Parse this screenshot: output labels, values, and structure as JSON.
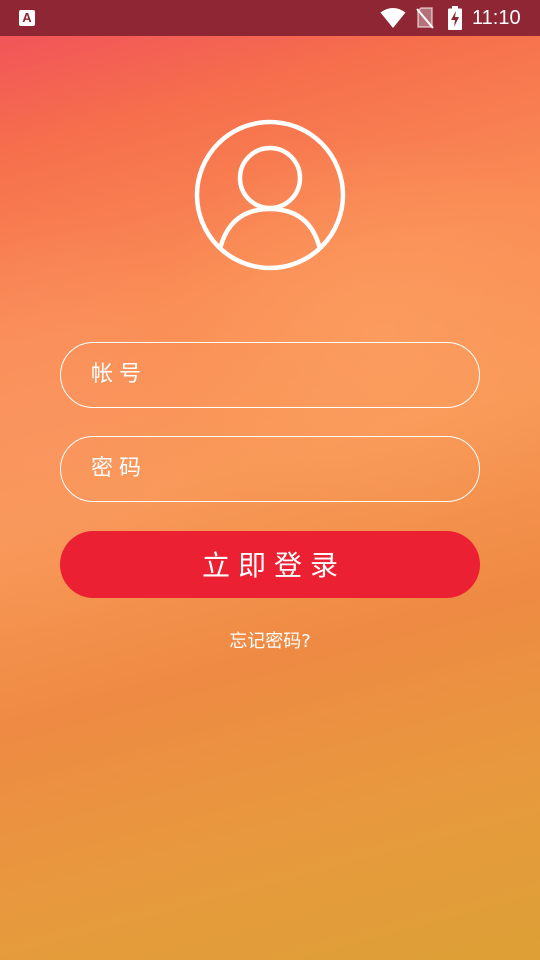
{
  "status_bar": {
    "app_icon_glyph": "A",
    "time": "11:10",
    "icons": [
      "app-notification-icon",
      "wifi-icon",
      "no-sim-icon",
      "battery-charging-icon"
    ]
  },
  "login": {
    "avatar_icon": "user-avatar-icon",
    "username_placeholder": "帐号",
    "username_value": "",
    "password_placeholder": "密码",
    "password_value": "",
    "login_button_label": "立即登录",
    "forgot_password_label": "忘记密码?"
  },
  "colors": {
    "status_bar": "#8e2633",
    "login_button": "#eb2032",
    "text": "#ffffff",
    "gradient_top": "#f04c5e",
    "gradient_bottom": "#dda036"
  }
}
